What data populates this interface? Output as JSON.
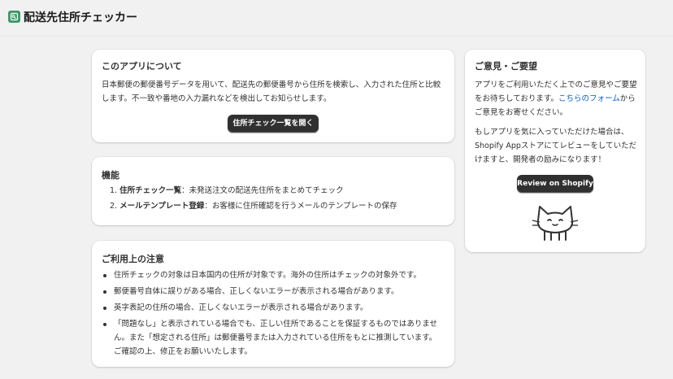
{
  "app": {
    "title": "配送先住所チェッカー",
    "icon": "app-logo-icon"
  },
  "about": {
    "title": "このアプリについて",
    "description": "日本郵便の郵便番号データを用いて、配送先の郵便番号から住所を検索し、入力された住所と比較します。不一致や番地の入力漏れなどを検出してお知らせします。",
    "button_label": "住所チェック一覧を開く"
  },
  "features": {
    "title": "機能",
    "items": [
      {
        "num": "1.",
        "name": "住所チェック一覧",
        "desc": "：未発送注文の配送先住所をまとめてチェック"
      },
      {
        "num": "2.",
        "name": "メールテンプレート登録",
        "desc": "：お客様に住所確認を行うメールのテンプレートの保存"
      }
    ]
  },
  "notes": {
    "title": "ご利用上の注意",
    "items": [
      "住所チェックの対象は日本国内の住所が対象です。海外の住所はチェックの対象外です。",
      "郵便番号自体に誤りがある場合、正しくないエラーが表示される場合があります。",
      "英字表記の住所の場合、正しくないエラーが表示される場合があります。",
      "「問題なし」と表示されている場合でも、正しい住所であることを保証するものではありません。また「想定される住所」は郵便番号または入力されている住所をもとに推測しています。ご確認の上、修正をお願いいたします。"
    ]
  },
  "feedback": {
    "title": "ご意見・ご要望",
    "text_before": "アプリをご利用いただく上でのご意見やご要望をお待ちしております。",
    "link_text": "こちらのフォーム",
    "text_after": "からご意見をお寄せください。",
    "review_text": "もしアプリを気に入っていただけた場合は、Shopify Appストアにてレビューをしていただけますと、開発者の励みになります！",
    "review_button_label": "Review on Shopify",
    "illustration": "cat-icon"
  }
}
